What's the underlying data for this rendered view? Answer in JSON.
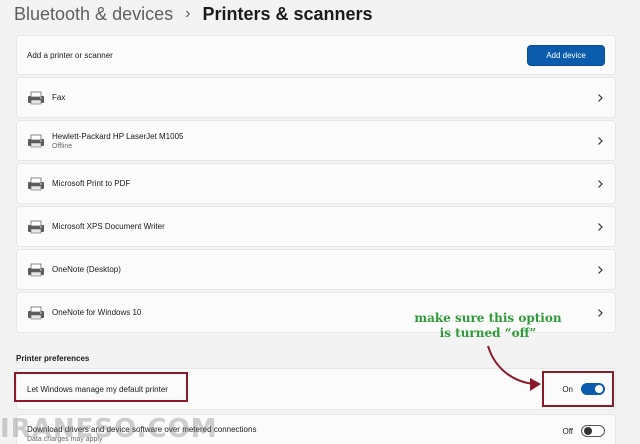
{
  "breadcrumb": {
    "parent": "Bluetooth & devices",
    "separator": "›",
    "current": "Printers & scanners"
  },
  "add_printer": {
    "label": "Add a printer or scanner",
    "button_label": "Add device"
  },
  "devices": [
    {
      "name": "Fax",
      "status": "",
      "icon": "fax-icon"
    },
    {
      "name": "Hewlett-Packard HP LaserJet M1005",
      "status": "Offline",
      "icon": "printer-icon"
    },
    {
      "name": "Microsoft Print to PDF",
      "status": "",
      "icon": "printer-icon"
    },
    {
      "name": "Microsoft XPS Document Writer",
      "status": "",
      "icon": "printer-icon"
    },
    {
      "name": "OneNote (Desktop)",
      "status": "",
      "icon": "printer-icon"
    },
    {
      "name": "OneNote for Windows 10",
      "status": "",
      "icon": "printer-icon"
    }
  ],
  "preferences": {
    "title": "Printer preferences",
    "default_printer": {
      "label": "Let Windows manage my default printer",
      "state": "On",
      "value": true
    },
    "metered": {
      "label": "Download drivers and device software over metered connections",
      "sublabel": "Data charges may apply",
      "state": "Off",
      "value": false
    }
  },
  "annotation": {
    "line1": "make sure this option",
    "line2": "is turned “off”",
    "color": "#2f9a3a",
    "highlight_color": "#8b1a2b"
  },
  "watermark": "IRANESO.COM",
  "colors": {
    "accent": "#0b5cad",
    "background": "#f3f3f3",
    "card": "#fbfbfb"
  }
}
